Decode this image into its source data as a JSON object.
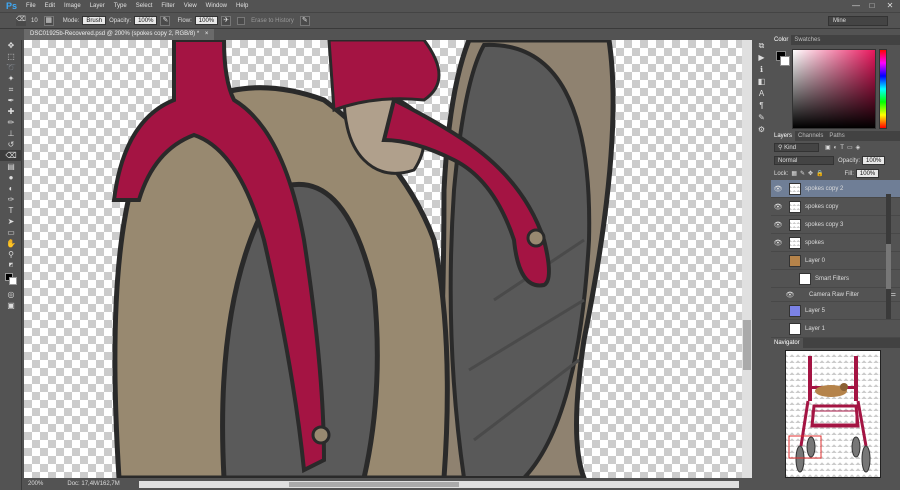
{
  "app": {
    "logo": "Ps"
  },
  "menu": [
    "File",
    "Edit",
    "Image",
    "Layer",
    "Type",
    "Select",
    "Filter",
    "View",
    "Window",
    "Help"
  ],
  "window_controls": {
    "minimize": "—",
    "restore": "□",
    "close": "✕"
  },
  "options": {
    "brush_size": "10",
    "mode_label": "Mode:",
    "mode_value": "Brush",
    "opacity_label": "Opacity:",
    "opacity_value": "100%",
    "flow_label": "Flow:",
    "flow_value": "100%",
    "erase_history": "Erase to History",
    "workspace": "Mine"
  },
  "document": {
    "tab_title": "DSC01925b-Recovered.psd @ 200% (spokes copy 2, RGB/8) *",
    "close": "×"
  },
  "status": {
    "zoom": "200%",
    "doc": "Doc: 17,4M/162,7M"
  },
  "color_panel": {
    "tabs": [
      "Color",
      "Swatches"
    ],
    "colors": {
      "fg": "#000000",
      "bg": "#ffffff",
      "hue": "#e8175d"
    }
  },
  "layers_panel": {
    "tabs": [
      "Layers",
      "Channels",
      "Paths"
    ],
    "kind": "Kind",
    "blend_mode": "Normal",
    "opacity_label": "Opacity:",
    "opacity_value": "100%",
    "lock_label": "Lock:",
    "fill_label": "Fill:",
    "fill_value": "100%",
    "layers": [
      {
        "name": "spokes copy 2",
        "visible": true,
        "selected": true
      },
      {
        "name": "spokes copy",
        "visible": true,
        "selected": false
      },
      {
        "name": "spokes copy 3",
        "visible": true,
        "selected": false
      },
      {
        "name": "spokes",
        "visible": true,
        "selected": false
      },
      {
        "name": "Layer 0",
        "visible": false,
        "selected": false
      },
      {
        "name": "Smart Filters",
        "visible": false,
        "selected": false
      },
      {
        "name": "Camera Raw Filter",
        "visible": true,
        "selected": false
      },
      {
        "name": "Layer 5",
        "visible": false,
        "selected": false
      },
      {
        "name": "Layer 1",
        "visible": false,
        "selected": false
      }
    ]
  },
  "navigator": {
    "title": "Navigator"
  },
  "colors": {
    "accent": "#a41443",
    "tan": "#988970",
    "wheel": "#5a5a5a",
    "selection": "#6f7e96"
  }
}
